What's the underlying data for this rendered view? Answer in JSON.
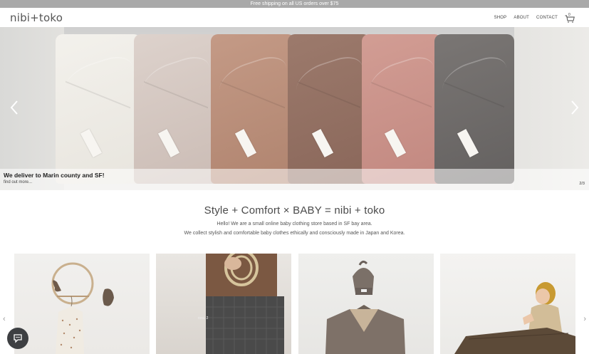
{
  "announcement": {
    "text": "Free shipping on all US orders over $75"
  },
  "header": {
    "logo": "nibi+toko",
    "nav": {
      "shop": "SHOP",
      "about": "ABOUT",
      "contact": "CONTACT"
    },
    "cart_count": "0"
  },
  "hero": {
    "caption_title": "We deliver to Marin county and SF!",
    "caption_link": "find out more...",
    "slide_counter": "2/3",
    "icons": {
      "prev": "chevron-left-icon",
      "next": "chevron-right-icon"
    }
  },
  "intro": {
    "title": "Style + Comfort × BABY = nibi + toko",
    "line1": "Hello! We are a small online baby clothing store based in SF bay area.",
    "line2": "We collect stylish and comfortable baby clothes ethically and consciously made in Japan and Korea."
  },
  "products": {
    "label_2": "rora. 2",
    "arrow_prev": "‹",
    "arrow_next": "›"
  },
  "colors": {
    "announcement_bg": "#a9a9a9",
    "chat_bg": "#3d3f42"
  }
}
